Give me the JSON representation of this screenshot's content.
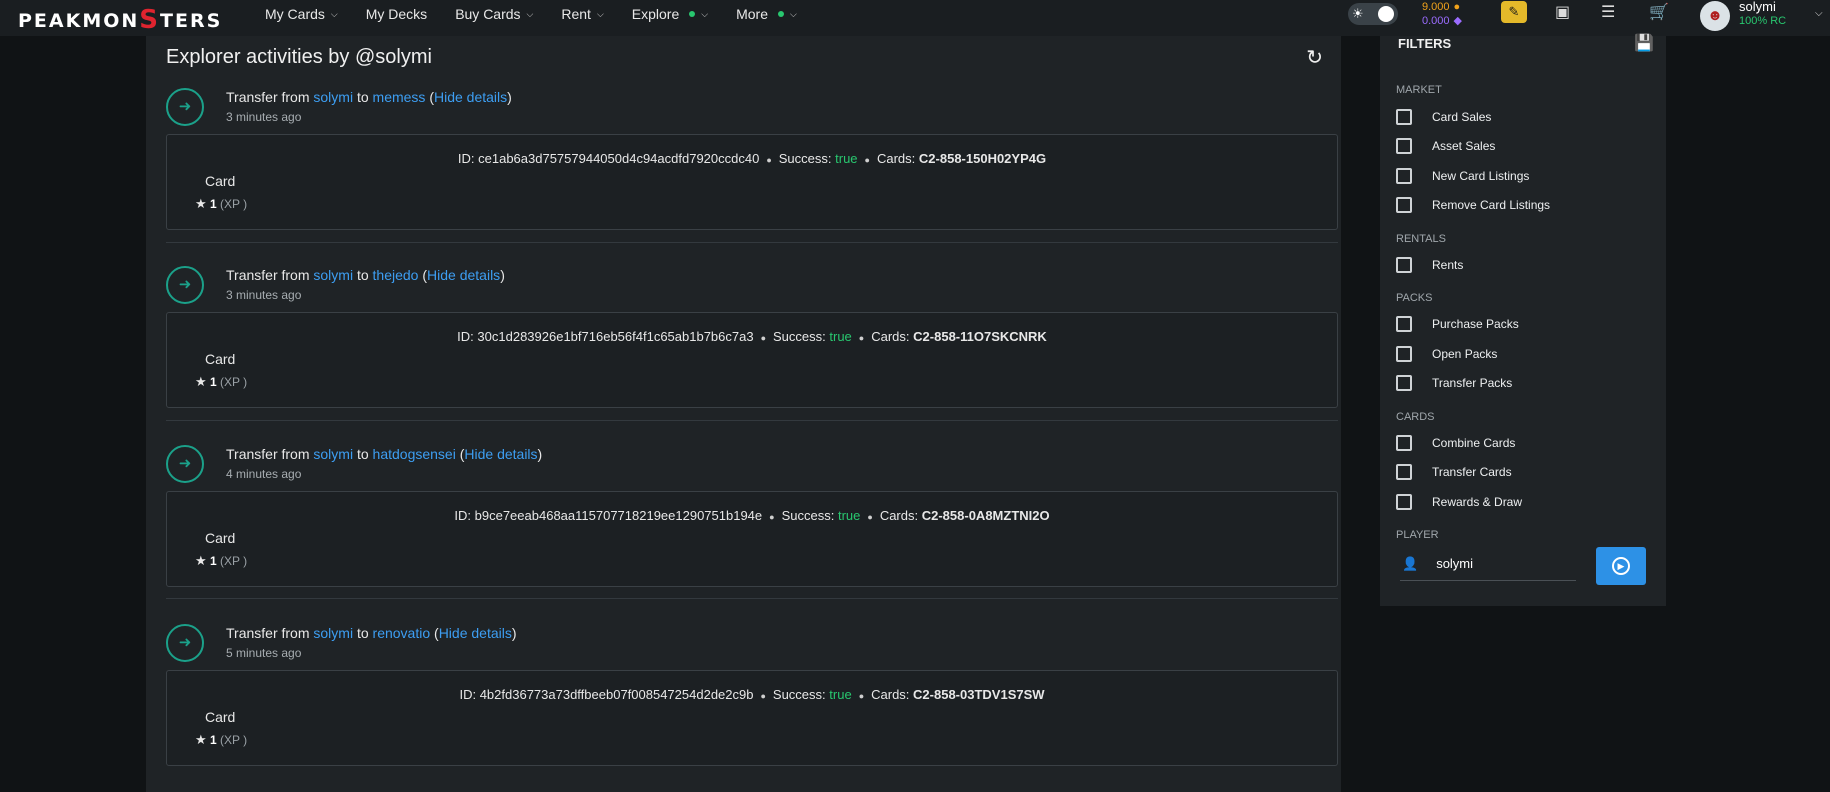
{
  "app": {
    "logo_pre": "PEAKMON",
    "logo_s": "S",
    "logo_post": "TERS"
  },
  "nav": {
    "items": [
      {
        "label": "My Cards",
        "chevron": true,
        "dot": false
      },
      {
        "label": "My Decks",
        "chevron": false,
        "dot": false
      },
      {
        "label": "Buy Cards",
        "chevron": true,
        "dot": false
      },
      {
        "label": "Rent",
        "chevron": true,
        "dot": false
      },
      {
        "label": "Explore",
        "chevron": true,
        "dot": true
      },
      {
        "label": "More",
        "chevron": true,
        "dot": true
      }
    ]
  },
  "header": {
    "balance1": "9.000",
    "balance2": "0.000",
    "username": "solymi",
    "rc": "100% RC",
    "icons": [
      "theme-toggle-icon",
      "chat-icon",
      "inbox-icon",
      "layers-icon",
      "cart-icon",
      "avatar"
    ]
  },
  "main": {
    "title": "Explorer activities by @solymi",
    "activities": [
      {
        "prefix": "Transfer from",
        "from": "solymi",
        "to_word": "to",
        "to": "memess",
        "hide_label": "Hide details",
        "time": "3 minutes ago",
        "id_label": "ID:",
        "id": "ce1ab6a3d75757944050d4c94acdfd7920ccdc40",
        "success_label": "Success:",
        "success": "true",
        "cards_label": "Cards:",
        "cards": "C2-858-150H02YP4G",
        "card_label": "Card",
        "level": "1",
        "xp": "(XP )"
      },
      {
        "prefix": "Transfer from",
        "from": "solymi",
        "to_word": "to",
        "to": "thejedo",
        "hide_label": "Hide details",
        "time": "3 minutes ago",
        "id_label": "ID:",
        "id": "30c1d283926e1bf716eb56f4f1c65ab1b7b6c7a3",
        "success_label": "Success:",
        "success": "true",
        "cards_label": "Cards:",
        "cards": "C2-858-11O7SKCNRK",
        "card_label": "Card",
        "level": "1",
        "xp": "(XP )"
      },
      {
        "prefix": "Transfer from",
        "from": "solymi",
        "to_word": "to",
        "to": "hatdogsensei",
        "hide_label": "Hide details",
        "time": "4 minutes ago",
        "id_label": "ID:",
        "id": "b9ce7eeab468aa115707718219ee1290751b194e",
        "success_label": "Success:",
        "success": "true",
        "cards_label": "Cards:",
        "cards": "C2-858-0A8MZTNI2O",
        "card_label": "Card",
        "level": "1",
        "xp": "(XP )"
      },
      {
        "prefix": "Transfer from",
        "from": "solymi",
        "to_word": "to",
        "to": "renovatio",
        "hide_label": "Hide details",
        "time": "5 minutes ago",
        "id_label": "ID:",
        "id": "4b2fd36773a73dffbeeb07f008547254d2de2c9b",
        "success_label": "Success:",
        "success": "true",
        "cards_label": "Cards:",
        "cards": "C2-858-03TDV1S7SW",
        "card_label": "Card",
        "level": "1",
        "xp": "(XP )"
      }
    ]
  },
  "filters": {
    "title": "FILTERS",
    "sections": [
      {
        "label": "MARKET",
        "items": [
          "Card Sales",
          "Asset Sales",
          "New Card Listings",
          "Remove Card Listings"
        ]
      },
      {
        "label": "RENTALS",
        "items": [
          "Rents"
        ]
      },
      {
        "label": "PACKS",
        "items": [
          "Purchase Packs",
          "Open Packs",
          "Transfer Packs"
        ]
      },
      {
        "label": "CARDS",
        "items": [
          "Combine Cards",
          "Transfer Cards",
          "Rewards & Draw"
        ]
      }
    ],
    "player_label": "PLAYER",
    "player_value": "solymi"
  }
}
